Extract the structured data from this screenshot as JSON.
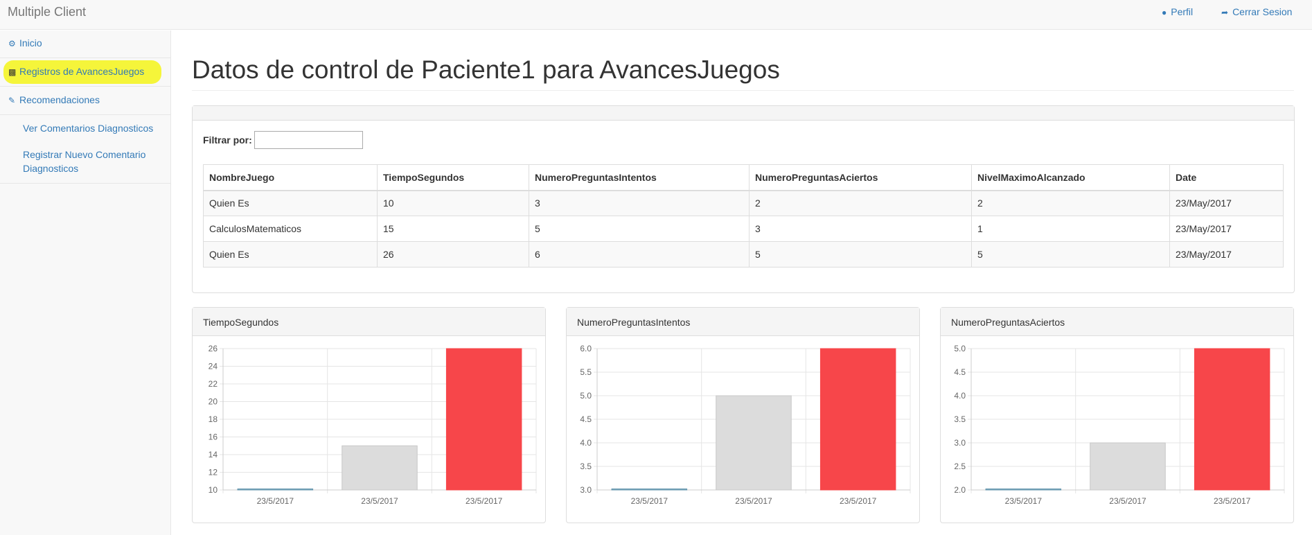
{
  "app": {
    "title": "Multiple Client"
  },
  "topnav": {
    "profile": "Perfil",
    "logout": "Cerrar Sesion"
  },
  "sidebar": {
    "items": [
      {
        "label": "Inicio"
      },
      {
        "label": "Registros de AvancesJuegos"
      },
      {
        "label": "Recomendaciones"
      },
      {
        "label": "Ver Comentarios Diagnosticos"
      },
      {
        "label": "Registrar Nuevo Comentario Diagnosticos"
      }
    ]
  },
  "page": {
    "title": "Datos de control de Paciente1 para AvancesJuegos",
    "filter_label": "Filtrar por:",
    "filter_value": ""
  },
  "table": {
    "headers": [
      "NombreJuego",
      "TiempoSegundos",
      "NumeroPreguntasIntentos",
      "NumeroPreguntasAciertos",
      "NivelMaximoAlcanzado",
      "Date"
    ],
    "rows": [
      [
        "Quien Es",
        "10",
        "3",
        "2",
        "2",
        "23/May/2017"
      ],
      [
        "CalculosMatematicos",
        "15",
        "5",
        "3",
        "1",
        "23/May/2017"
      ],
      [
        "Quien Es",
        "26",
        "6",
        "5",
        "5",
        "23/May/2017"
      ]
    ]
  },
  "colors": {
    "bar1": "#97bbcd",
    "bar2": "#dcdcdc",
    "bar3": "#f7464a",
    "link": "#337ab7"
  },
  "chart_data": [
    {
      "type": "bar",
      "title": "TiempoSegundos",
      "categories": [
        "23/5/2017",
        "23/5/2017",
        "23/5/2017"
      ],
      "values": [
        10,
        15,
        26
      ],
      "ylim": [
        10,
        26
      ],
      "yticks": [
        "10",
        "12",
        "14",
        "16",
        "18",
        "20",
        "22",
        "24",
        "26"
      ],
      "grid": true
    },
    {
      "type": "bar",
      "title": "NumeroPreguntasIntentos",
      "categories": [
        "23/5/2017",
        "23/5/2017",
        "23/5/2017"
      ],
      "values": [
        3,
        5,
        6
      ],
      "ylim": [
        3,
        6
      ],
      "yticks": [
        "3.0",
        "3.5",
        "4.0",
        "4.5",
        "5.0",
        "5.5",
        "6.0"
      ],
      "grid": true
    },
    {
      "type": "bar",
      "title": "NumeroPreguntasAciertos",
      "categories": [
        "23/5/2017",
        "23/5/2017",
        "23/5/2017"
      ],
      "values": [
        2,
        3,
        5
      ],
      "ylim": [
        2,
        5
      ],
      "yticks": [
        "2.0",
        "2.5",
        "3.0",
        "3.5",
        "4.0",
        "4.5",
        "5.0"
      ],
      "grid": true
    }
  ]
}
